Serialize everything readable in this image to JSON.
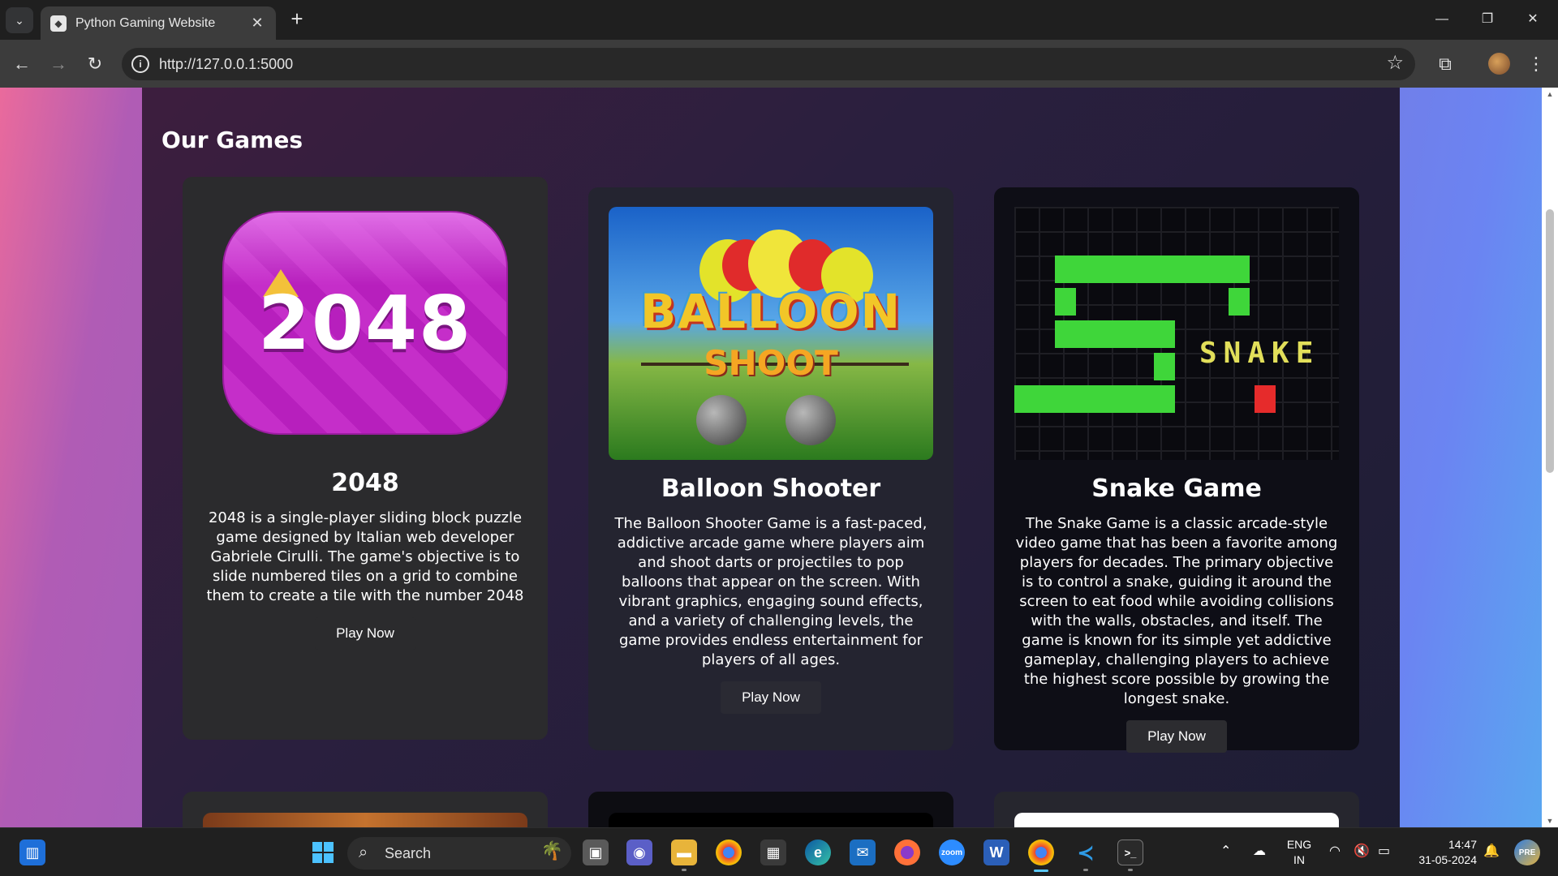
{
  "browser": {
    "tab_title": "Python Gaming Website",
    "url": "http://127.0.0.1:5000"
  },
  "page": {
    "section_title": "Our Games",
    "games": [
      {
        "title": "2048",
        "image_text": "2048",
        "description": "2048 is a single-player sliding block puzzle game designed by Italian web developer Gabriele Cirulli. The game's objective is to slide numbered tiles on a grid to combine them to create a tile with the number 2048",
        "button": "Play Now"
      },
      {
        "title": "Balloon Shooter",
        "image_text_1": "BALLOON",
        "image_text_2": "SHOOT",
        "description": "The Balloon Shooter Game is a fast-paced, addictive arcade game where players aim and shoot darts or projectiles to pop balloons that appear on the screen. With vibrant graphics, engaging sound effects, and a variety of challenging levels, the game provides endless entertainment for players of all ages.",
        "button": "Play Now"
      },
      {
        "title": "Snake Game",
        "image_text": "SNAKE",
        "description": "The Snake Game is a classic arcade-style video game that has been a favorite among players for decades. The primary objective is to control a snake, guiding it around the screen to eat food while avoiding collisions with the walls, obstacles, and itself. The game is known for its simple yet addictive gameplay, challenging players to achieve the highest score possible by growing the longest snake.",
        "button": "Play Now"
      }
    ]
  },
  "taskbar": {
    "search_placeholder": "Search",
    "lang_top": "ENG",
    "lang_bottom": "IN",
    "time": "14:47",
    "date": "31-05-2024"
  },
  "colors": {
    "page_gradient_left": "#ea6a9c",
    "page_gradient_right": "#5aa6f0",
    "panel": "#2a1f3e",
    "snake_green": "#3fd63a",
    "food_red": "#e62b2b"
  }
}
